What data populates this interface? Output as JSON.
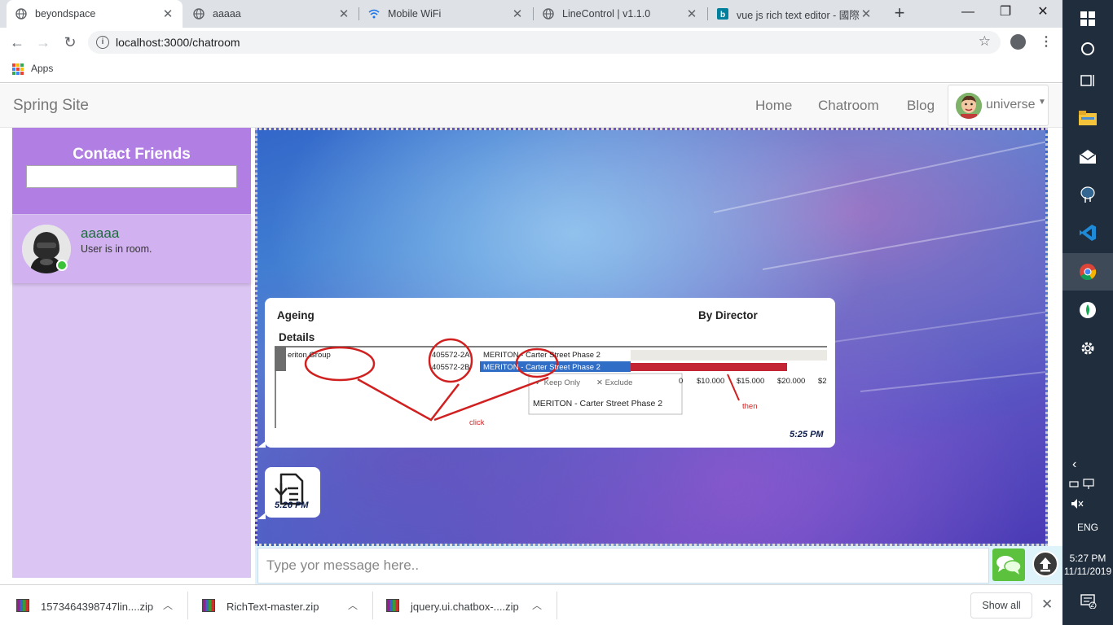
{
  "browser": {
    "tabs": [
      {
        "title": "beyondspace",
        "active": true,
        "icon": "globe-icon"
      },
      {
        "title": "aaaaa",
        "active": false,
        "icon": "globe-icon"
      },
      {
        "title": "Mobile WiFi",
        "active": false,
        "icon": "wifi-icon"
      },
      {
        "title": "LineControl | v1.1.0",
        "active": false,
        "icon": "globe-icon"
      },
      {
        "title": "vue js rich text editor - 國際",
        "active": false,
        "icon": "bing-icon"
      }
    ],
    "url": "localhost:3000/chatroom",
    "bookmarks_apps_label": "Apps"
  },
  "navbar": {
    "brand": "Spring Site",
    "links": [
      "Home",
      "Chatroom",
      "Blog"
    ],
    "user": "universe"
  },
  "sidebar": {
    "title": "Contact Friends",
    "search_value": "",
    "contacts": [
      {
        "name": "aaaaa",
        "status": "User is in room.",
        "online": true
      }
    ]
  },
  "chat": {
    "messages": [
      {
        "kind": "image",
        "time": "5:25 PM",
        "image_text": {
          "heading_left": "Ageing",
          "heading_right": "By Director",
          "subheading": "Details",
          "row1_col1": "eriton Group",
          "row1_col2": "405572-2A",
          "row1_col3": "MERITON - Carter Street Phase 2",
          "row2_col2": "405572-2B",
          "row2_col3": "MERITON - Carter Street Phase 2",
          "menu_keep": "Keep Only",
          "menu_exclude": "Exclude",
          "menu_item": "MERITON - Carter Street Phase 2",
          "axis_ticks": [
            "0",
            "$10.000",
            "$15.000",
            "$20.000",
            "$2"
          ],
          "note_click": "click",
          "note_then": "then"
        }
      },
      {
        "kind": "file",
        "time": "5:26 PM",
        "icon": "file-download-icon"
      }
    ],
    "input_placeholder": "Type yor message here.."
  },
  "downloads": {
    "items": [
      {
        "name": "1573464398747lin....zip"
      },
      {
        "name": "RichText-master.zip"
      },
      {
        "name": "jquery.ui.chatbox-....zip"
      }
    ],
    "show_all": "Show all"
  },
  "taskbar": {
    "lang": "ENG",
    "time": "5:27 PM",
    "date": "11/11/2019",
    "notifications": "2"
  },
  "colors": {
    "sidebar_header": "#b17fe3",
    "sidebar_bg": "#dbc5f2",
    "contact_bg": "#d1b1f0",
    "contact_name": "#1d6c3e",
    "send_button": "#5cc23e",
    "taskbar": "#1f2d3d"
  }
}
